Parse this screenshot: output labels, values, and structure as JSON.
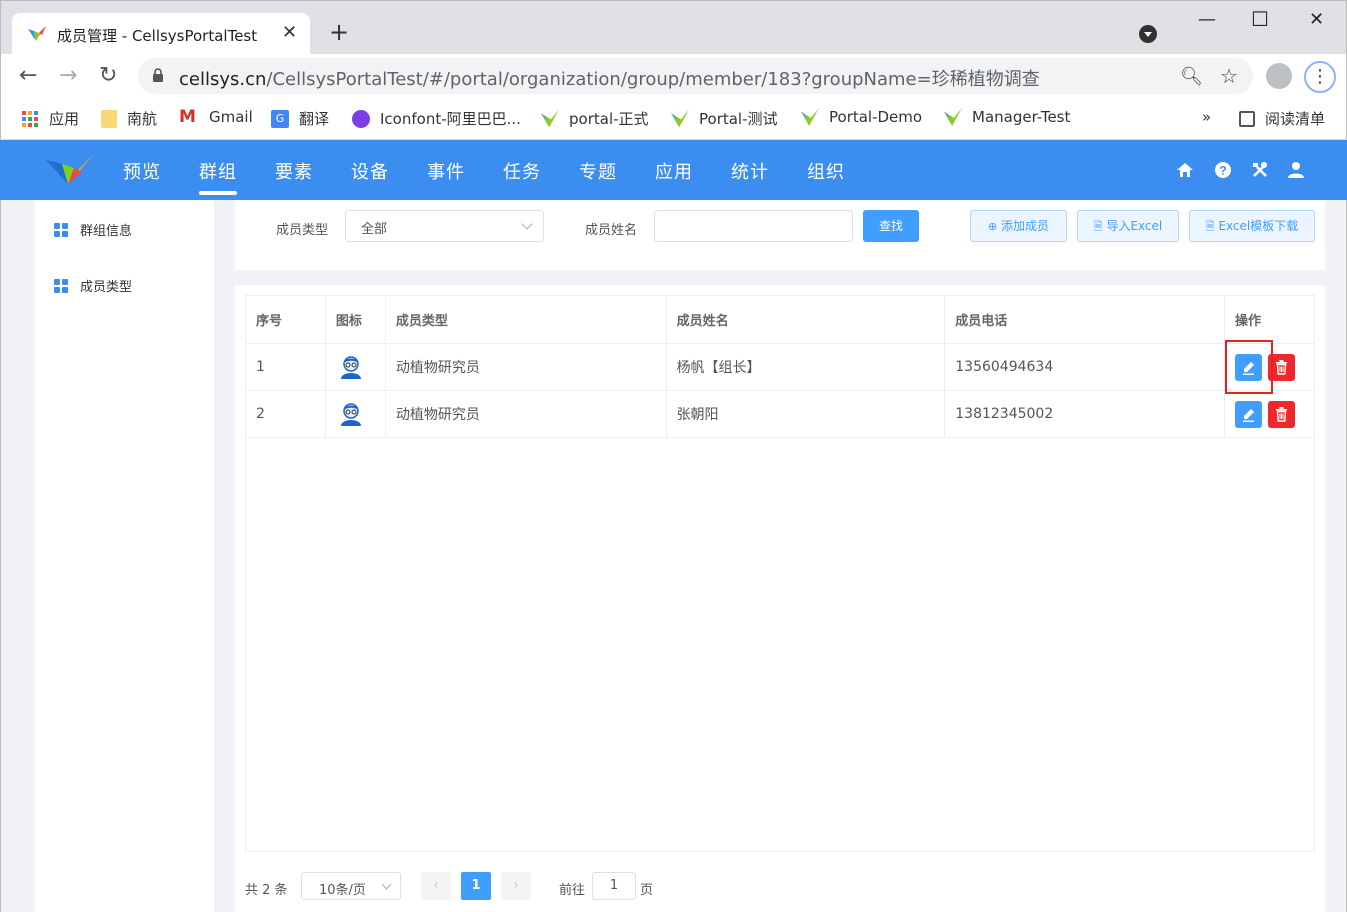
{
  "browser": {
    "tab_title": "成员管理 - CellsysPortalTest",
    "url_host": "cellsys.cn",
    "url_path": "/CellsysPortalTest/#/portal/organization/group/member/183?groupName=珍稀植物调查",
    "bookmarks": [
      "应用",
      "南航",
      "Gmail",
      "翻译",
      "Iconfont-阿里巴巴...",
      "portal-正式",
      "Portal-测试",
      "Portal-Demo",
      "Manager-Test"
    ],
    "overflow": "»",
    "reading_list": "阅读清单"
  },
  "app": {
    "nav": [
      "预览",
      "群组",
      "要素",
      "设备",
      "事件",
      "任务",
      "专题",
      "应用",
      "统计",
      "组织"
    ],
    "active_nav": "群组",
    "accent": "#3b8ef0"
  },
  "sidebar": {
    "items": [
      {
        "label": "群组信息",
        "icon": "grid-icon"
      },
      {
        "label": "成员类型",
        "icon": "grid-icon"
      }
    ]
  },
  "filter": {
    "type_label": "成员类型",
    "type_value": "全部",
    "name_label": "成员姓名",
    "name_value": "",
    "search_button": "查找",
    "add_button": "添加成员",
    "import_button": "导入Excel",
    "template_button": "Excel模板下载"
  },
  "table": {
    "headers": [
      "序号",
      "图标",
      "成员类型",
      "成员姓名",
      "成员电话",
      "操作"
    ],
    "rows": [
      {
        "index": "1",
        "type": "动植物研究员",
        "name": "杨帆【组长】",
        "phone": "13560494634"
      },
      {
        "index": "2",
        "type": "动植物研究员",
        "name": "张朝阳",
        "phone": "13812345002"
      }
    ]
  },
  "pagination": {
    "total": "共 2 条",
    "page_size": "10条/页",
    "current_page": "1",
    "goto_label": "前往",
    "goto_value": "1",
    "page_suffix": "页"
  }
}
